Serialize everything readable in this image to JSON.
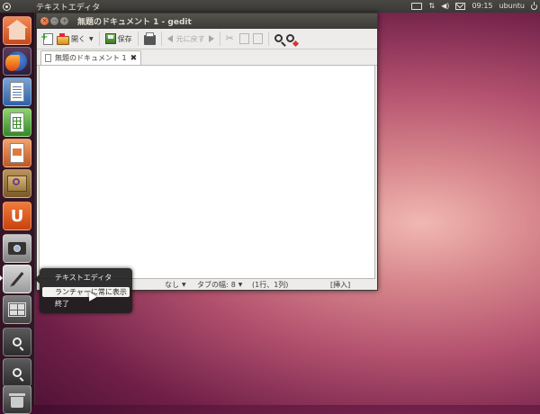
{
  "top_panel": {
    "app_title": "テキストエディタ",
    "clock": "09:15",
    "user": "ubuntu"
  },
  "launcher": {
    "items": [
      {
        "name": "home-folder",
        "icon": "home-folder-icon"
      },
      {
        "name": "firefox",
        "icon": "firefox-icon"
      },
      {
        "name": "libreoffice-writer",
        "icon": "writer-icon"
      },
      {
        "name": "libreoffice-calc",
        "icon": "calc-icon"
      },
      {
        "name": "libreoffice-impress",
        "icon": "impress-icon"
      },
      {
        "name": "software-center",
        "icon": "software-center-icon"
      },
      {
        "name": "ubuntu-one",
        "icon": "ubuntu-one-icon",
        "glyph": "U"
      },
      {
        "name": "screenshot",
        "icon": "camera-icon"
      },
      {
        "name": "text-editor",
        "icon": "gedit-icon"
      },
      {
        "name": "workspace-switcher",
        "icon": "workspace-icon"
      },
      {
        "name": "zoom-in",
        "icon": "zoom-in-icon"
      },
      {
        "name": "zoom-out",
        "icon": "zoom-out-icon"
      },
      {
        "name": "trash",
        "icon": "trash-icon"
      }
    ]
  },
  "window": {
    "title": "無題のドキュメント 1 - gedit",
    "toolbar": {
      "open_label": "開く",
      "save_label": "保存",
      "undo_label": "元に戻す"
    },
    "tab": {
      "label": "無題のドキュメント 1",
      "close_glyph": "✖"
    },
    "statusbar": {
      "language": "なし",
      "tab_width_label": "タブの幅:",
      "tab_width_value": "8",
      "position": "(1行、1列)",
      "mode": "[挿入]"
    }
  },
  "quicklist": {
    "title": "テキストエディタ",
    "keep_in_launcher": "ランチャーに常に表示",
    "quit": "終了"
  },
  "colors": {
    "accent": "#dd4814",
    "panel": "#3c3b37"
  }
}
